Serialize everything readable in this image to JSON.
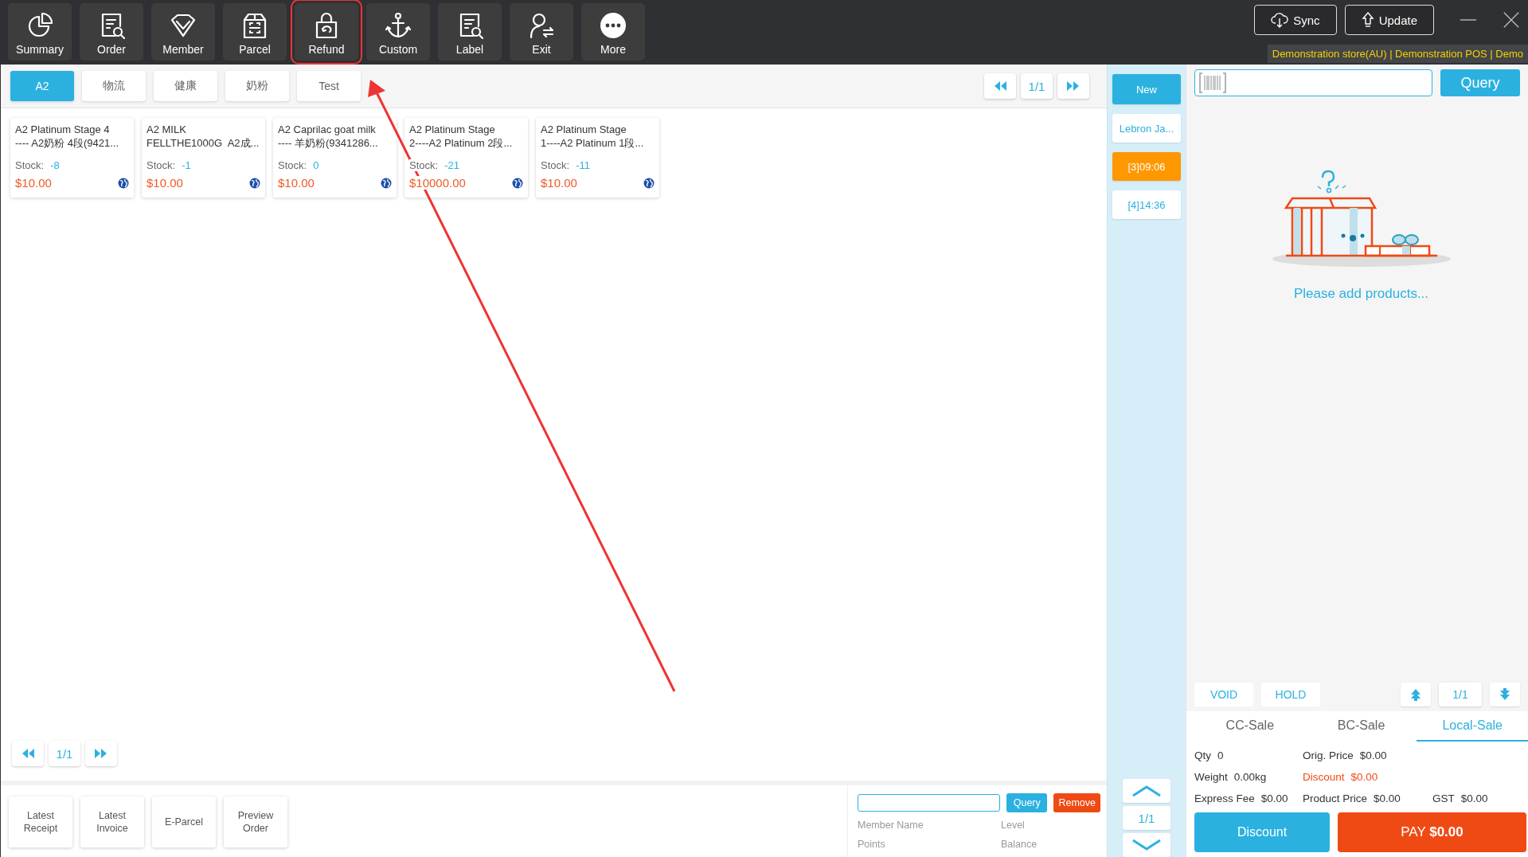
{
  "toolbar": {
    "items": [
      {
        "label": "Summary",
        "highlighted": false
      },
      {
        "label": "Order",
        "highlighted": false
      },
      {
        "label": "Member",
        "highlighted": false
      },
      {
        "label": "Parcel",
        "highlighted": false
      },
      {
        "label": "Refund",
        "highlighted": true
      },
      {
        "label": "Custom",
        "highlighted": false
      },
      {
        "label": "Label",
        "highlighted": false
      },
      {
        "label": "Exit",
        "highlighted": false
      },
      {
        "label": "More",
        "highlighted": false
      }
    ],
    "sync": "Sync",
    "update": "Update",
    "store_info": "Demonstration store(AU) | Demonstration POS | Demo"
  },
  "categories": [
    {
      "label": "A2",
      "selected": true
    },
    {
      "label": "物流",
      "selected": false
    },
    {
      "label": "健康",
      "selected": false
    },
    {
      "label": "奶粉",
      "selected": false
    },
    {
      "label": "Test",
      "selected": false
    }
  ],
  "category_pager": "1/1",
  "products": [
    {
      "name": "A2 Platinum Stage 4\n---- A2奶粉 4段(9421...",
      "stock_label": "Stock:",
      "stock": "-8",
      "price": "$10.00"
    },
    {
      "name": "A2 MILK\nFELLTHE1000G  A2成...",
      "stock_label": "Stock:",
      "stock": "-1",
      "price": "$10.00"
    },
    {
      "name": "A2 Caprilac goat milk\n---- 羊奶粉(9341286...",
      "stock_label": "Stock:",
      "stock": "0",
      "price": "$10.00"
    },
    {
      "name": "A2 Platinum Stage\n2----A2 Platinum 2段...",
      "stock_label": "Stock:",
      "stock": "-21",
      "price": "$10000.00"
    },
    {
      "name": "A2 Platinum Stage\n1----A2 Platinum 1段...",
      "stock_label": "Stock:",
      "stock": "-11",
      "price": "$10.00"
    }
  ],
  "product_pager": "1/1",
  "bottom_buttons": [
    "Latest\nReceipt",
    "Latest\nInvoice",
    "E-Parcel",
    "Preview\nOrder"
  ],
  "member": {
    "query": "Query",
    "remove": "Remove",
    "fields": [
      "Member Name",
      "Level",
      "Points",
      "Balance"
    ]
  },
  "tickets": {
    "new": "New",
    "items": [
      {
        "label": "Lebron Ja...",
        "selected": false
      },
      {
        "label": "[3]09:06",
        "selected": true
      },
      {
        "label": "[4]14:36",
        "selected": false
      }
    ],
    "pager": "1/1"
  },
  "cart": {
    "query": "Query",
    "empty_message": "Please add products...",
    "void": "VOID",
    "hold": "HOLD",
    "pager": "1/1",
    "sale_tabs": [
      {
        "label": "CC-Sale",
        "selected": false
      },
      {
        "label": "BC-Sale",
        "selected": false
      },
      {
        "label": "Local-Sale",
        "selected": true
      }
    ],
    "summary": [
      {
        "label": "Qty",
        "value": "0",
        "kind": "normal"
      },
      {
        "label": "Orig. Price",
        "value": "$0.00",
        "kind": "normal"
      },
      {
        "kind": "empty"
      },
      {
        "label": "Weight",
        "value": "0.00kg",
        "kind": "normal"
      },
      {
        "label": "Discount",
        "value": "$0.00",
        "kind": "alert"
      },
      {
        "kind": "empty"
      },
      {
        "label": "Express Fee",
        "value": "$0.00",
        "kind": "normal"
      },
      {
        "label": "Product Price",
        "value": "$0.00",
        "kind": "normal"
      },
      {
        "label": "GST",
        "value": "$0.00",
        "kind": "normal"
      }
    ],
    "discount": "Discount",
    "pay": "PAY **$0.00**"
  },
  "callout_arrow": true
}
